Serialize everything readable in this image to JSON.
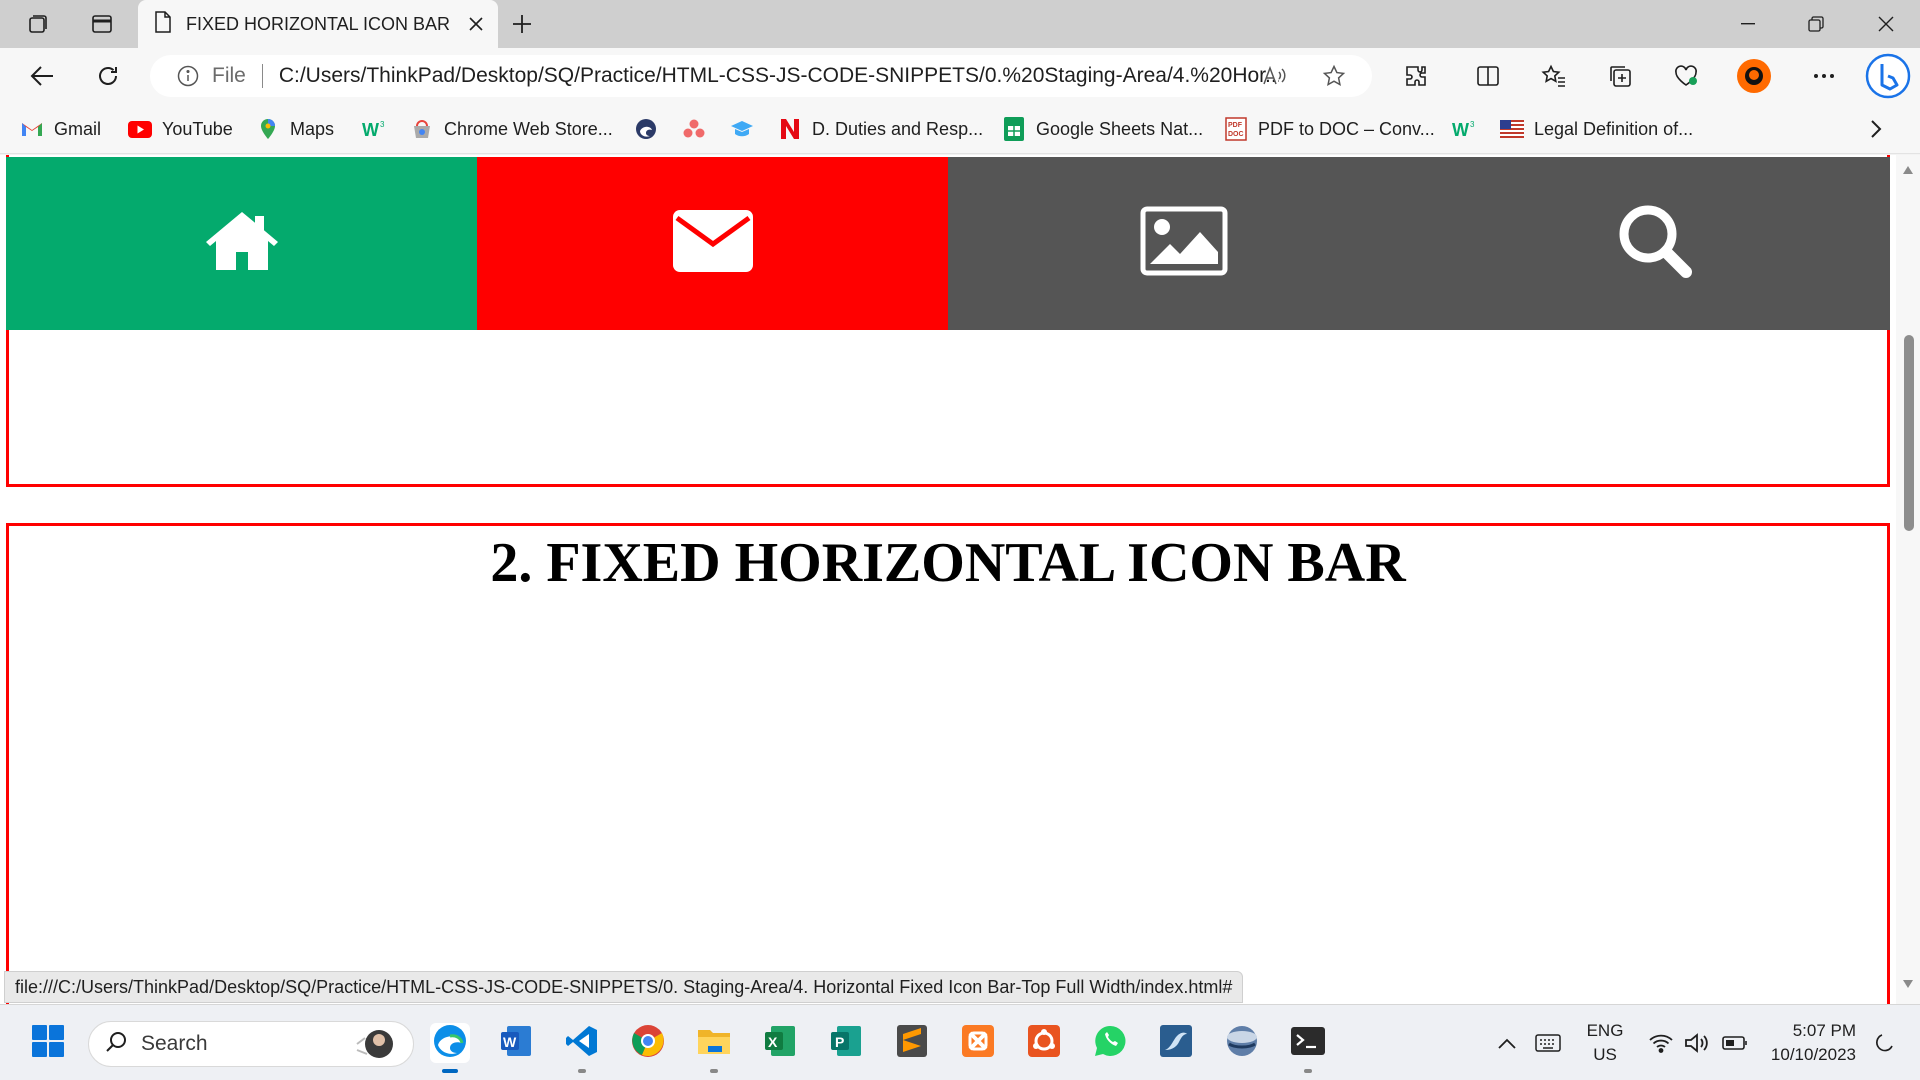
{
  "browser": {
    "tab_title": "FIXED HORIZONTAL ICON BAR",
    "address_prefix": "File",
    "address_url": "C:/Users/ThinkPad/Desktop/SQ/Practice/HTML-CSS-JS-CODE-SNIPPETS/0.%20Staging-Area/4.%20Hor...",
    "status_url": "file:///C:/Users/ThinkPad/Desktop/SQ/Practice/HTML-CSS-JS-CODE-SNIPPETS/0. Staging-Area/4. Horizontal Fixed Icon Bar-Top Full Width/index.html#"
  },
  "favorites": [
    {
      "label": "Gmail",
      "icon": "gmail-icon"
    },
    {
      "label": "YouTube",
      "icon": "youtube-icon"
    },
    {
      "label": "Maps",
      "icon": "maps-icon"
    },
    {
      "label": "",
      "icon": "w3schools-icon"
    },
    {
      "label": "Chrome Web Store...",
      "icon": "chrome-web-store-icon"
    },
    {
      "label": "",
      "icon": "edge-icon"
    },
    {
      "label": "",
      "icon": "asana-icon"
    },
    {
      "label": "",
      "icon": "graduation-cap-icon"
    },
    {
      "label": "D. Duties and Resp...",
      "icon": "n-icon"
    },
    {
      "label": "Google Sheets Nat...",
      "icon": "google-sheets-icon"
    },
    {
      "label": "PDF to DOC – Conv...",
      "icon": "pdf-doc-icon"
    },
    {
      "label": "",
      "icon": "w3schools-icon"
    },
    {
      "label": "Legal Definition of...",
      "icon": "us-flag-icon"
    }
  ],
  "page": {
    "heading": "2. FIXED HORIZONTAL ICON BAR",
    "iconbar": [
      {
        "icon": "home-icon",
        "color": "#04aa6d"
      },
      {
        "icon": "envelope-icon",
        "color": "#ff0000"
      },
      {
        "icon": "image-icon",
        "color": "#555555"
      },
      {
        "icon": "search-icon",
        "color": "#555555"
      }
    ],
    "border_color": "#ff0000"
  },
  "taskbar": {
    "search_placeholder": "Search",
    "apps": [
      "edge-icon",
      "word-icon",
      "vscode-icon",
      "chrome-icon",
      "file-explorer-icon",
      "excel-icon",
      "publisher-icon",
      "sublime-text-icon",
      "xampp-icon",
      "ubuntu-icon",
      "whatsapp-icon",
      "mysql-workbench-icon",
      "globe-icon",
      "terminal-icon"
    ],
    "lang_line1": "ENG",
    "lang_line2": "US",
    "time": "5:07 PM",
    "date": "10/10/2023"
  }
}
